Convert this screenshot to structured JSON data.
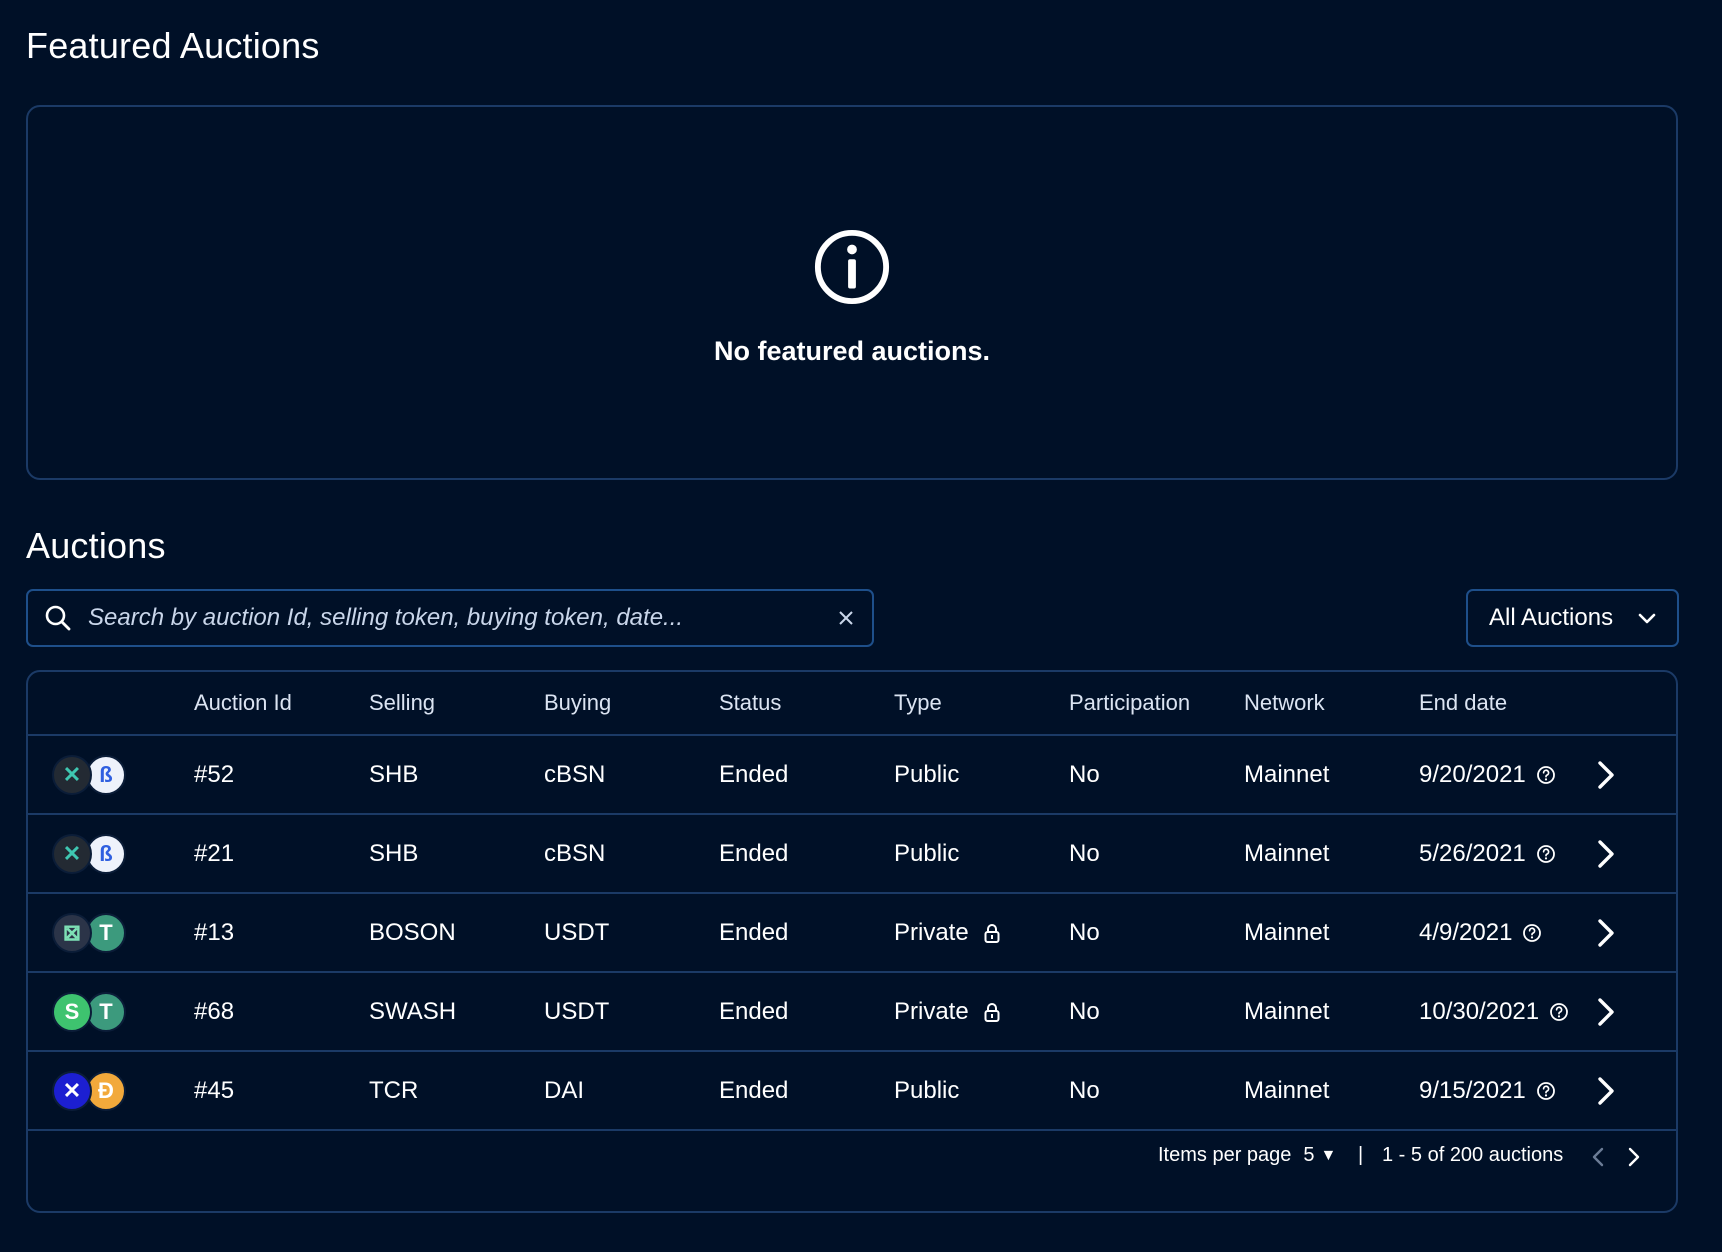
{
  "featured": {
    "title": "Featured Auctions",
    "empty_message": "No featured auctions."
  },
  "auctions": {
    "title": "Auctions",
    "search": {
      "placeholder": "Search by auction Id, selling token, buying token, date...",
      "value": ""
    },
    "filter": {
      "selected": "All Auctions"
    },
    "columns": [
      "",
      "Auction Id",
      "Selling",
      "Buying",
      "Status",
      "Type",
      "Participation",
      "Network",
      "End date"
    ],
    "rows": [
      {
        "id": "#52",
        "selling": "SHB",
        "buying": "cBSN",
        "status": "Ended",
        "type": "Public",
        "private": false,
        "participation": "No",
        "network": "Mainnet",
        "end_date": "9/20/2021",
        "sell_icon": {
          "name": "shb-token-icon",
          "bg": "#232a33",
          "fg": "#3fc6b1",
          "glyph": "✕"
        },
        "buy_icon": {
          "name": "cbsn-token-icon",
          "bg": "#eef2fb",
          "fg": "#2f5fe0",
          "glyph": "ß"
        }
      },
      {
        "id": "#21",
        "selling": "SHB",
        "buying": "cBSN",
        "status": "Ended",
        "type": "Public",
        "private": false,
        "participation": "No",
        "network": "Mainnet",
        "end_date": "5/26/2021",
        "sell_icon": {
          "name": "shb-token-icon",
          "bg": "#232a33",
          "fg": "#3fc6b1",
          "glyph": "✕"
        },
        "buy_icon": {
          "name": "cbsn-token-icon",
          "bg": "#eef2fb",
          "fg": "#2f5fe0",
          "glyph": "ß"
        }
      },
      {
        "id": "#13",
        "selling": "BOSON",
        "buying": "USDT",
        "status": "Ended",
        "type": "Private",
        "private": true,
        "participation": "No",
        "network": "Mainnet",
        "end_date": "4/9/2021",
        "sell_icon": {
          "name": "boson-token-icon",
          "bg": "#2b3448",
          "fg": "#7ee0b5",
          "glyph": "⊠"
        },
        "buy_icon": {
          "name": "usdt-token-icon",
          "bg": "#3c9a7d",
          "fg": "#ffffff",
          "glyph": "T"
        }
      },
      {
        "id": "#68",
        "selling": "SWASH",
        "buying": "USDT",
        "status": "Ended",
        "type": "Private",
        "private": true,
        "participation": "No",
        "network": "Mainnet",
        "end_date": "10/30/2021",
        "sell_icon": {
          "name": "swash-token-icon",
          "bg": "#3ec36f",
          "fg": "#ffffff",
          "glyph": "S"
        },
        "buy_icon": {
          "name": "usdt-token-icon",
          "bg": "#3c9a7d",
          "fg": "#ffffff",
          "glyph": "T"
        }
      },
      {
        "id": "#45",
        "selling": "TCR",
        "buying": "DAI",
        "status": "Ended",
        "type": "Public",
        "private": false,
        "participation": "No",
        "network": "Mainnet",
        "end_date": "9/15/2021",
        "sell_icon": {
          "name": "tcr-token-icon",
          "bg": "#1c1fd1",
          "fg": "#ffffff",
          "glyph": "✕"
        },
        "buy_icon": {
          "name": "dai-token-icon",
          "bg": "#f2a93b",
          "fg": "#ffffff",
          "glyph": "Đ"
        }
      }
    ],
    "pagination": {
      "items_per_page_label": "Items per page",
      "items_per_page": "5",
      "separator": "|",
      "range_text": "1 - 5 of 200 auctions"
    }
  },
  "colors": {
    "background": "#001027",
    "border": "#1b3a66",
    "input_border": "#1e4f8a",
    "text": "#ffffff"
  }
}
